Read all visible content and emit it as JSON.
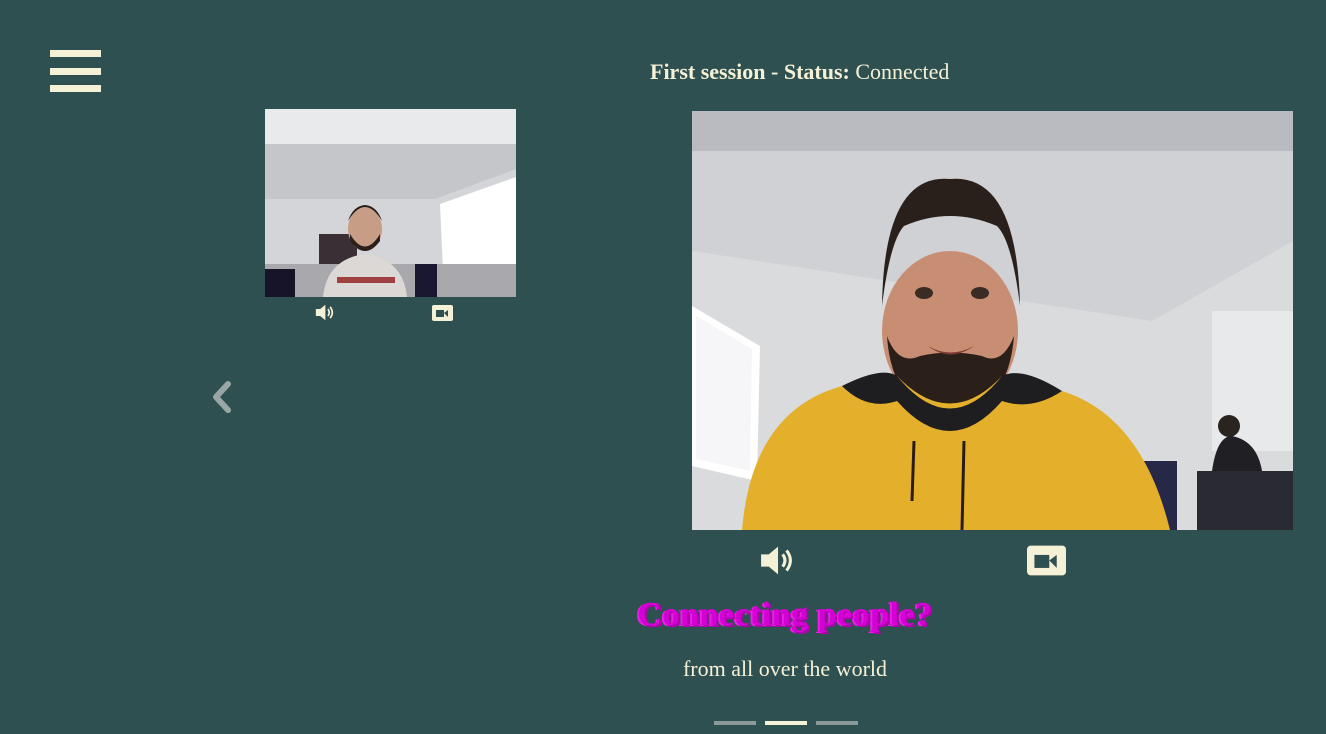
{
  "header": {
    "session_name": "First session",
    "separator": "-",
    "status_label": "Status:",
    "status_value": "Connected"
  },
  "menu": {
    "icon": "hamburger-menu-icon"
  },
  "local_video": {
    "audio_icon": "speaker-volume-icon",
    "camera_icon": "video-camera-icon"
  },
  "remote_video": {
    "audio_icon": "speaker-volume-icon",
    "camera_icon": "video-camera-icon"
  },
  "carousel": {
    "prev_icon": "chevron-left-icon",
    "heading": "Connecting people?",
    "subheading": "from all over the world",
    "slides": 3,
    "active_slide": 2
  },
  "colors": {
    "background": "#2f5050",
    "text": "#f5f1d6",
    "heading": "#d400d4",
    "indicator_inactive": "#8a9a9a"
  }
}
